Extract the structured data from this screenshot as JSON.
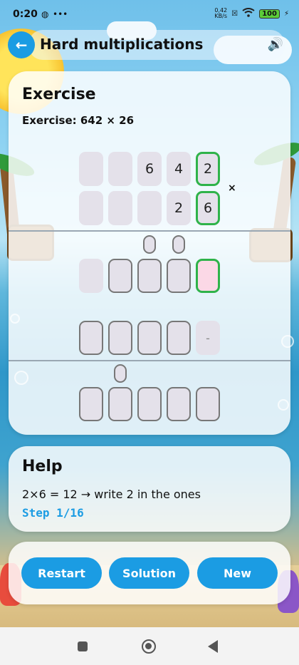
{
  "status": {
    "time": "0:20",
    "speed_top": "0,42",
    "speed_bottom": "KB/s",
    "battery": "100"
  },
  "app": {
    "title": "Hard multiplications"
  },
  "exercise": {
    "heading": "Exercise",
    "subtitle": "Exercise: 642 × 26",
    "operator": "×",
    "row1": [
      "",
      "",
      "6",
      "4",
      "2"
    ],
    "row2": [
      "",
      "",
      "",
      "2",
      "6"
    ],
    "partial1": [
      "",
      "",
      "",
      "",
      ""
    ],
    "partial2": [
      "",
      "",
      "",
      "",
      "-"
    ],
    "result": [
      "",
      "",
      "",
      "",
      ""
    ]
  },
  "help": {
    "heading": "Help",
    "text": "2×6 = 12 → write 2 in the ones",
    "step": "Step 1/16"
  },
  "buttons": {
    "restart": "Restart",
    "solution": "Solution",
    "new": "New"
  },
  "colors": {
    "accent": "#1b9ce3",
    "active_border": "#2fb34a",
    "active_fill": "#fbd8e6"
  }
}
